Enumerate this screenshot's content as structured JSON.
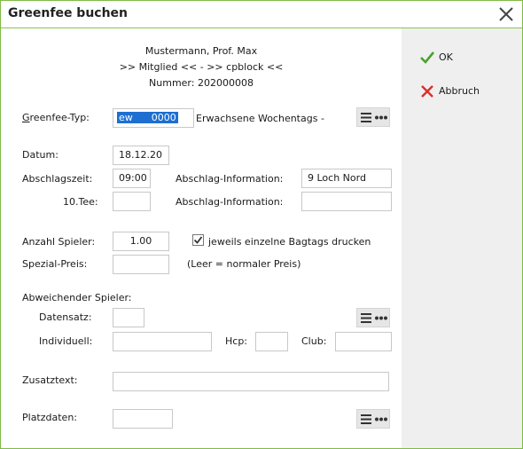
{
  "window": {
    "title": "Greenfee buchen"
  },
  "header": {
    "name": "Mustermann, Prof. Max",
    "member_line": ">> Mitglied << - >> cpblock <<",
    "number": "Nummer: 202000008"
  },
  "form": {
    "greenfee_type_label": "Greenfee-Typ:",
    "greenfee_type_value": "ew      0000",
    "greenfee_type_desc": "Erwachsene Wochentags -",
    "datum_label": "Datum:",
    "datum_value": "18.12.20",
    "abschlagszeit_label": "Abschlagszeit:",
    "abschlagszeit_value": "09:00",
    "abschlag_info_label": "Abschlag-Information:",
    "abschlag_info_value": "9 Loch Nord",
    "tee10_label": "10.Tee:",
    "tee10_value": "",
    "abschlag_info2_label": "Abschlag-Information:",
    "abschlag_info2_value": "",
    "anzahl_label": "Anzahl Spieler:",
    "anzahl_value": "1.00",
    "bagtags_label": "jeweils einzelne Bagtags drucken",
    "bagtags_checked": true,
    "spezial_label": "Spezial-Preis:",
    "spezial_value": "",
    "spezial_hint": "(Leer = normaler Preis)",
    "abweichender_label": "Abweichender Spieler:",
    "datensatz_label": "Datensatz:",
    "datensatz_value": "",
    "individuell_label": "Individuell:",
    "individuell_value": "",
    "hcp_label": "Hcp:",
    "hcp_value": "",
    "club_label": "Club:",
    "club_value": "",
    "zusatztext_label": "Zusatztext:",
    "zusatztext_value": "",
    "platzdaten_label": "Platzdaten:",
    "platzdaten_value": ""
  },
  "side": {
    "ok_label": "OK",
    "abbruch_label": "Abbruch"
  },
  "colors": {
    "accent": "#7fba45",
    "ok_green": "#4aa12d",
    "cancel_red": "#d9302b",
    "selection": "#1e6fd0"
  },
  "icons": {
    "close": "close-icon",
    "ok": "checkmark-icon",
    "cancel": "x-icon",
    "menu": "hamburger-icon",
    "more": "ellipsis-icon"
  }
}
